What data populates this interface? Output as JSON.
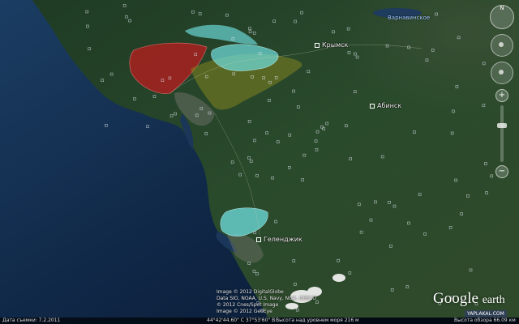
{
  "places": [
    {
      "id": "krymsk",
      "label": "Крымск"
    },
    {
      "id": "abinsk",
      "label": "Абинск"
    },
    {
      "id": "gelendzhik",
      "label": "Геленджик"
    }
  ],
  "water_label": "Варнавинское",
  "copyright": {
    "line1": "Image © 2012 DigitalGlobe",
    "line2": "Data SIO, NOAA, U.S. Navy, NGA, GEBCO",
    "line3": "© 2012 Cnes/Spot Image",
    "line4": "Image © 2012 GeoEye"
  },
  "logo": {
    "google": "Google",
    "earth": "earth"
  },
  "watermark": "YAPLAKAL.COM",
  "nav": {
    "north": "N",
    "zoom_in": "+",
    "zoom_out": "−",
    "zoom_level": 0.35
  },
  "status": {
    "date": "Дата съемки: 7.2.2011",
    "coords": "44°42'44.60\" С  37°53'60\" В",
    "elevation": "Высота над уровнем моря  216 м",
    "eye_alt": "Высота обзора  66.09 км"
  },
  "colors": {
    "sea_deep": "#102a4a",
    "land": "#24442a",
    "flood_red": "#b01e1e",
    "flood_cyan": "#6fe0e0",
    "flood_olive": "#8a8a1e"
  }
}
